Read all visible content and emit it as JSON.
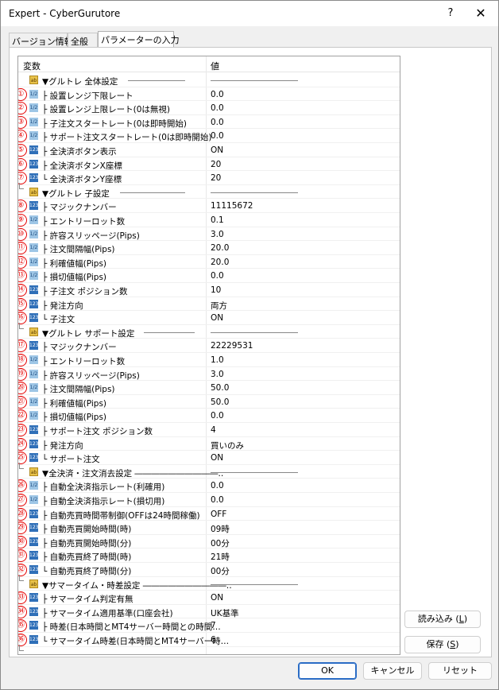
{
  "window": {
    "title": "Expert - CyberGurutore",
    "help_label": "?",
    "close_label": "✕"
  },
  "tabs": [
    {
      "label": "バージョン情報",
      "active": false
    },
    {
      "label": "全般",
      "active": false
    },
    {
      "label": "パラメーターの入力",
      "active": true
    }
  ],
  "grid": {
    "col_name": "変数",
    "col_value": "値"
  },
  "rows": [
    {
      "num": "",
      "icon": "ab",
      "name": "▼グルトレ 全体設定",
      "value": "",
      "header": true,
      "line_end": 210
    },
    {
      "num": "①",
      "icon": "1/2",
      "name": "├ 設置レンジ下限レート",
      "value": "0.0"
    },
    {
      "num": "②",
      "icon": "1/2",
      "name": "├ 設置レンジ上限レート(0は無視)",
      "value": "0.0"
    },
    {
      "num": "③",
      "icon": "1/2",
      "name": "├ 子注文スタートレート(0は即時開始)",
      "value": "0.0"
    },
    {
      "num": "④",
      "icon": "1/2",
      "name": "├ サポート注文スタートレート(0は即時開始)",
      "value": "0.0"
    },
    {
      "num": "⑤",
      "icon": "123",
      "name": "├ 全決済ボタン表示",
      "value": "ON"
    },
    {
      "num": "⑥",
      "icon": "123",
      "name": "├ 全決済ボタンX座標",
      "value": "20"
    },
    {
      "num": "⑦",
      "icon": "123",
      "name": "└ 全決済ボタンY座標",
      "value": "20"
    },
    {
      "num": "",
      "icon": "ab",
      "name": "▼グルトレ 子設定",
      "value": "",
      "header": true,
      "line_end": 210
    },
    {
      "num": "⑧",
      "icon": "123",
      "name": "├ マジックナンバー",
      "value": "11115672"
    },
    {
      "num": "⑨",
      "icon": "1/2",
      "name": "├ エントリーロット数",
      "value": "0.1"
    },
    {
      "num": "⑩",
      "icon": "1/2",
      "name": "├ 許容スリッページ(Pips)",
      "value": "3.0"
    },
    {
      "num": "⑪",
      "icon": "1/2",
      "name": "├ 注文間隔幅(Pips)",
      "value": "20.0"
    },
    {
      "num": "⑫",
      "icon": "1/2",
      "name": "├ 利確値幅(Pips)",
      "value": "20.0"
    },
    {
      "num": "⑬",
      "icon": "1/2",
      "name": "├ 損切値幅(Pips)",
      "value": "0.0"
    },
    {
      "num": "⑭",
      "icon": "123",
      "name": "├ 子注文 ポジション数",
      "value": "10"
    },
    {
      "num": "⑮",
      "icon": "123",
      "name": "├ 発注方向",
      "value": "両方"
    },
    {
      "num": "⑯",
      "icon": "123",
      "name": "└ 子注文",
      "value": "ON"
    },
    {
      "num": "",
      "icon": "ab",
      "name": "▼グルトレ サポート設定",
      "value": "",
      "header": true,
      "line_end": 222
    },
    {
      "num": "⑰",
      "icon": "123",
      "name": "├ マジックナンバー",
      "value": "22229531"
    },
    {
      "num": "⑱",
      "icon": "1/2",
      "name": "├ エントリーロット数",
      "value": "1.0"
    },
    {
      "num": "⑲",
      "icon": "1/2",
      "name": "├ 許容スリッページ(Pips)",
      "value": "3.0"
    },
    {
      "num": "⑳",
      "icon": "1/2",
      "name": "├ 注文間隔幅(Pips)",
      "value": "50.0"
    },
    {
      "num": "㉑",
      "icon": "1/2",
      "name": "├ 利確値幅(Pips)",
      "value": "50.0"
    },
    {
      "num": "㉒",
      "icon": "1/2",
      "name": "├ 損切値幅(Pips)",
      "value": "0.0"
    },
    {
      "num": "㉓",
      "icon": "123",
      "name": "├ サポート注文 ポジション数",
      "value": "4"
    },
    {
      "num": "㉔",
      "icon": "123",
      "name": "├ 発注方向",
      "value": "買いのみ"
    },
    {
      "num": "㉕",
      "icon": "123",
      "name": "└ サポート注文",
      "value": "ON"
    },
    {
      "num": "",
      "icon": "ab",
      "name": "▼全決済・注文消去設定 ――――――――――‥",
      "value": "",
      "header": true
    },
    {
      "num": "㉖",
      "icon": "1/2",
      "name": "├ 自動全決済指示レート(利確用)",
      "value": "0.0"
    },
    {
      "num": "㉗",
      "icon": "1/2",
      "name": "├ 自動全決済指示レート(損切用)",
      "value": "0.0"
    },
    {
      "num": "㉘",
      "icon": "123",
      "name": "├ 自動売買時間帯制御(OFFは24時間稼働)",
      "value": "OFF"
    },
    {
      "num": "㉙",
      "icon": "123",
      "name": "├ 自動売買開始時間(時)",
      "value": "09時"
    },
    {
      "num": "㉚",
      "icon": "123",
      "name": "├ 自動売買開始時間(分)",
      "value": "00分"
    },
    {
      "num": "㉛",
      "icon": "123",
      "name": "├ 自動売買終了時間(時)",
      "value": "21時"
    },
    {
      "num": "㉜",
      "icon": "123",
      "name": "└ 自動売買終了時間(分)",
      "value": "00分"
    },
    {
      "num": "",
      "icon": "ab",
      "name": "▼サマータイム・時差設定 ――――――――――‥",
      "value": "",
      "header": true
    },
    {
      "num": "㉝",
      "icon": "123",
      "name": "├ サマータイム判定有無",
      "value": "ON"
    },
    {
      "num": "㉞",
      "icon": "123",
      "name": "├ サマータイム適用基準(口座会社)",
      "value": "UK基準"
    },
    {
      "num": "㉟",
      "icon": "123",
      "name": "├ 時差(日本時間とMT4サーバー時間との時間…",
      "value": "7"
    },
    {
      "num": "㊱",
      "icon": "123",
      "name": "└ サマータイム時差(日本時間とMT4サーバー時…",
      "value": "6"
    }
  ],
  "side_buttons": {
    "load": {
      "label": "読み込み",
      "accel": "L"
    },
    "save": {
      "label": "保存",
      "accel": "S"
    }
  },
  "footer": {
    "ok": "OK",
    "cancel": "キャンセル",
    "reset": "リセット"
  }
}
